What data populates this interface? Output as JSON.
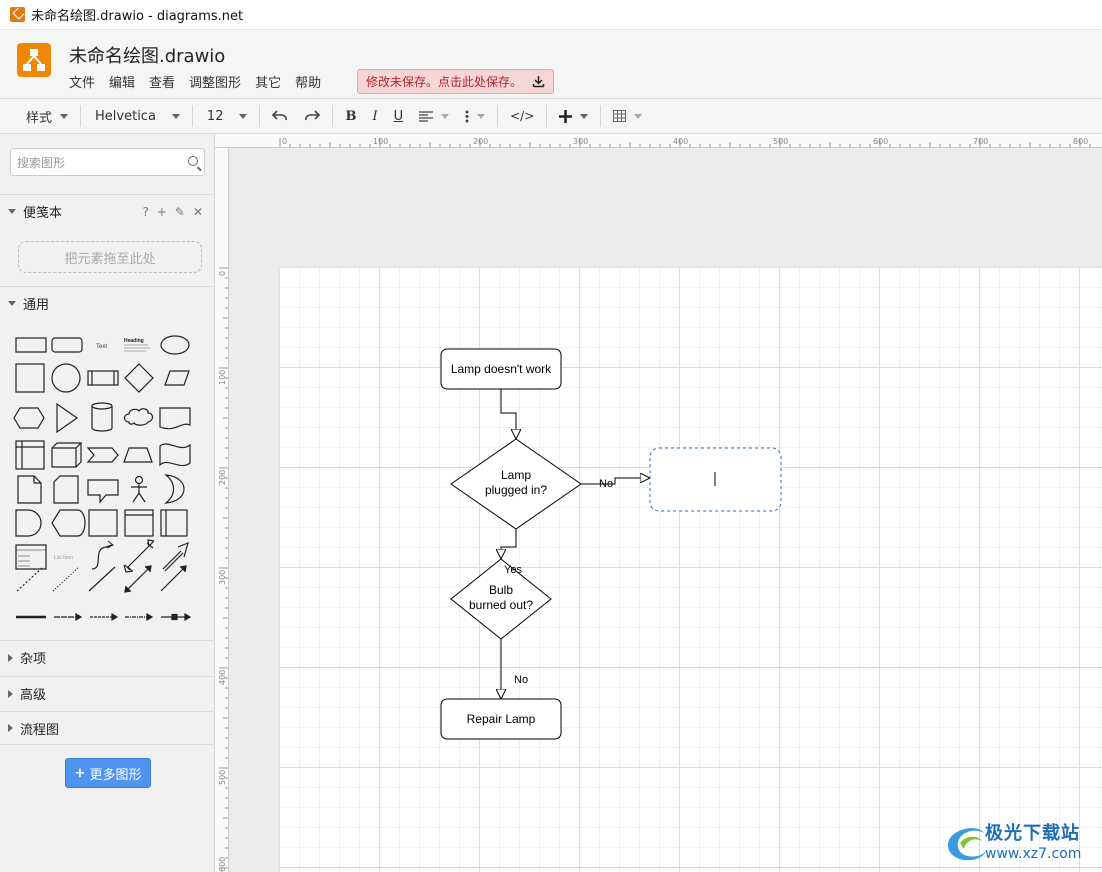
{
  "window": {
    "title": "未命名绘图.drawio - diagrams.net"
  },
  "app": {
    "doc_title": "未命名绘图.drawio",
    "menu": [
      "文件",
      "编辑",
      "查看",
      "调整图形",
      "其它",
      "帮助"
    ],
    "unsaved_notice": "修改未保存。点击此处保存。"
  },
  "toolbar": {
    "style_label": "样式",
    "font_name": "Helvetica",
    "font_size": "12",
    "bold": "B",
    "italic": "I",
    "underline": "U",
    "html": "</>"
  },
  "sidebar": {
    "search_placeholder": "搜索图形",
    "scratchpad": "便笺本",
    "dropzone": "把元素拖至此处",
    "general": "通用",
    "misc": "杂项",
    "advanced": "高级",
    "flowchart": "流程图",
    "more_shapes": "更多图形",
    "shape_labels": {
      "text": "Text",
      "heading": "Heading",
      "list": "List Item"
    }
  },
  "rulers": {
    "top": [
      "0",
      "100",
      "200",
      "300",
      "400",
      "500",
      "600",
      "700",
      "800"
    ],
    "left": [
      "0",
      "100",
      "200",
      "300",
      "400",
      "500",
      "600"
    ]
  },
  "diagram": {
    "start": "Lamp doesn't work",
    "decision1_line1": "Lamp",
    "decision1_line2": "plugged in?",
    "decision2_line1": "Bulb",
    "decision2_line2": "burned out?",
    "end": "Repair Lamp",
    "edge_no_1": "No",
    "edge_yes": "Yes",
    "edge_no_2": "No"
  },
  "watermark": {
    "brand": "极光下载站",
    "url": "www.xz7.com"
  },
  "colors": {
    "accent": "#f08705",
    "selection": "#2a6bb5",
    "button": "#4f95ef"
  }
}
